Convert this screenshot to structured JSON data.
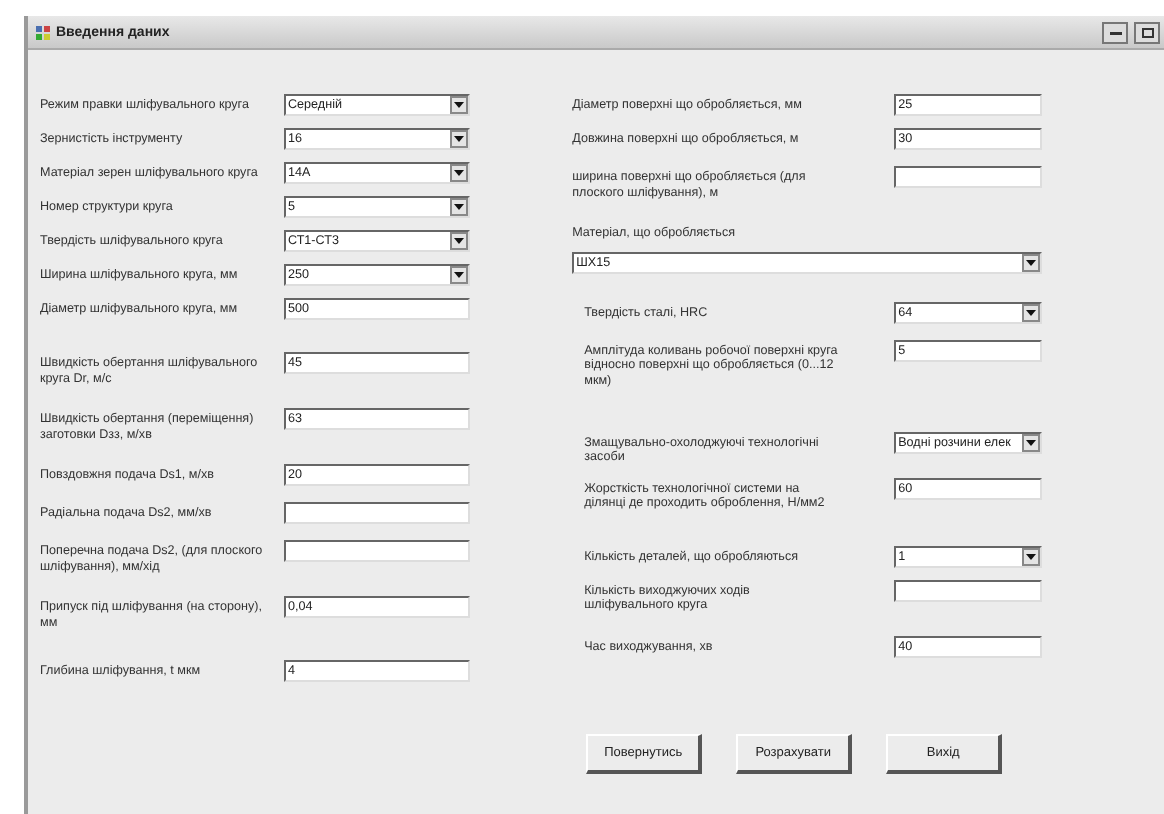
{
  "window": {
    "title": "Введення даних"
  },
  "left_fields": [
    {
      "kind": "combo",
      "label": "Режим правки шліфувального круга",
      "value": "Середній"
    },
    {
      "kind": "combo",
      "label": "Зернистість інструменту",
      "value": "16"
    },
    {
      "kind": "combo",
      "label": "Матеріал зерен шліфувального круга",
      "value": "14А"
    },
    {
      "kind": "combo",
      "label": "Номер структури круга",
      "value": "5"
    },
    {
      "kind": "combo",
      "label": "Твердість шліфувального круга",
      "value": "СТ1-СТ3"
    },
    {
      "kind": "combo",
      "label": "Ширина шліфувального круга, мм",
      "value": "250"
    },
    {
      "kind": "text",
      "label": "Діаметр шліфувального круга, мм",
      "value": "500"
    },
    {
      "kind": "text",
      "label": "Швидкість обертання шліфувального круга Dr,  м/с",
      "value": "45"
    },
    {
      "kind": "text",
      "label": "Швидкість обертання (переміщення) заготовки Dзз, м/хв",
      "value": "63"
    },
    {
      "kind": "text",
      "label": "Повздовжня подача Ds1, м/хв",
      "value": "20"
    },
    {
      "kind": "text",
      "label": "Радіальна подача Ds2, мм/хв"
    },
    {
      "kind": "text",
      "label": "Поперечна подача Ds2, (для плоского шліфування), мм/хід"
    },
    {
      "kind": "text",
      "label": "Припуск під шліфування (на сторону), мм",
      "value": "0,04"
    },
    {
      "kind": "text",
      "label": "Глибина шліфування, t мкм",
      "value": "4"
    }
  ],
  "right_fields": [
    {
      "kind": "text",
      "label": "Діаметр поверхні що обробляється, мм",
      "value": "25"
    },
    {
      "kind": "text",
      "label": "Довжина поверхні що обробляється, м",
      "value": "30"
    },
    {
      "kind": "text",
      "label": "ширина  поверхні що обробляється (для плоского шліфування), м"
    },
    {
      "kind": "wide-combo",
      "label": "Матеріал, що обробляється",
      "value": "ШХ15"
    },
    {
      "kind": "combo",
      "label": "Твердість сталі, HRC",
      "value": "64"
    },
    {
      "kind": "text",
      "label": "Амплітуда коливань робочої поверхні круга відносно поверхні що обробляється (0...12 мкм)",
      "value": "5"
    },
    {
      "kind": "combo",
      "label": "Змащувально-охолоджуючі технологічні засоби",
      "value": "Водні розчини елек"
    },
    {
      "kind": "text",
      "label": "Жорсткість технологічної системи на ділянці де проходить оброблення, Н/мм2",
      "value": "60"
    },
    {
      "kind": "combo",
      "label": "Кількість деталей, що обробляються",
      "value": "1"
    },
    {
      "kind": "text",
      "label": "Кількість виходжуючих ходів шліфувального круга"
    },
    {
      "kind": "text",
      "label": "Час виходжування, хв",
      "value": "40"
    }
  ],
  "buttons": [
    "Повернутись",
    "Розрахувати",
    "Вихід"
  ]
}
